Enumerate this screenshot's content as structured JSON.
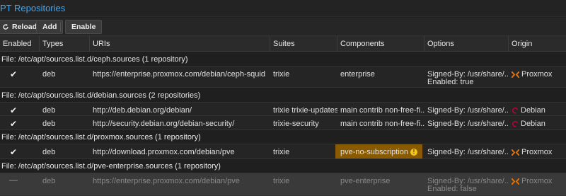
{
  "title": "PT Repositories",
  "toolbar": {
    "reload": "Reload",
    "add": "Add",
    "enable": "Enable"
  },
  "columns": [
    "Enabled",
    "Types",
    "URIs",
    "Suites",
    "Components",
    "Options",
    "Origin"
  ],
  "groups": [
    {
      "label": "File: /etc/apt/sources.list.d/ceph.sources (1 repository)"
    },
    {
      "label": "File: /etc/apt/sources.list.d/debian.sources (2 repositories)"
    },
    {
      "label": "File: /etc/apt/sources.list.d/proxmox.sources (1 repository)"
    },
    {
      "label": "File: /etc/apt/sources.list.d/pve-enterprise.sources (1 repository)"
    }
  ],
  "rows": [
    {
      "enabled": "✔",
      "type": "deb",
      "uri": "https://enterprise.proxmox.com/debian/ceph-squid",
      "suites": "trixie",
      "components": "enterprise",
      "options": "Signed-By: /usr/share/...",
      "options2": "Enabled: true",
      "origin": "Proxmox"
    },
    {
      "enabled": "✔",
      "type": "deb",
      "uri": "http://deb.debian.org/debian/",
      "suites": "trixie trixie-updates",
      "components": "main contrib non-free-fi...",
      "options": "Signed-By: /usr/share/...",
      "origin": "Debian"
    },
    {
      "enabled": "✔",
      "type": "deb",
      "uri": "http://security.debian.org/debian-security/",
      "suites": "trixie-security",
      "components": "main contrib non-free-fi...",
      "options": "Signed-By: /usr/share/...",
      "origin": "Debian"
    },
    {
      "enabled": "✔",
      "type": "deb",
      "uri": "http://download.proxmox.com/debian/pve",
      "suites": "trixie",
      "components": "pve-no-subscription",
      "options": "Signed-By: /usr/share/...",
      "origin": "Proxmox"
    },
    {
      "enabled": "—",
      "type": "deb",
      "uri": "https://enterprise.proxmox.com/debian/pve",
      "suites": "trixie",
      "components": "pve-enterprise",
      "options": "Signed-By: /usr/share/...",
      "options2": "Enabled: false",
      "origin": "Proxmox"
    }
  ],
  "colors": {
    "accent": "#3fa9f5",
    "warning_bg": "#8a5a00",
    "proxmox": "#e57000",
    "debian": "#c70036"
  }
}
